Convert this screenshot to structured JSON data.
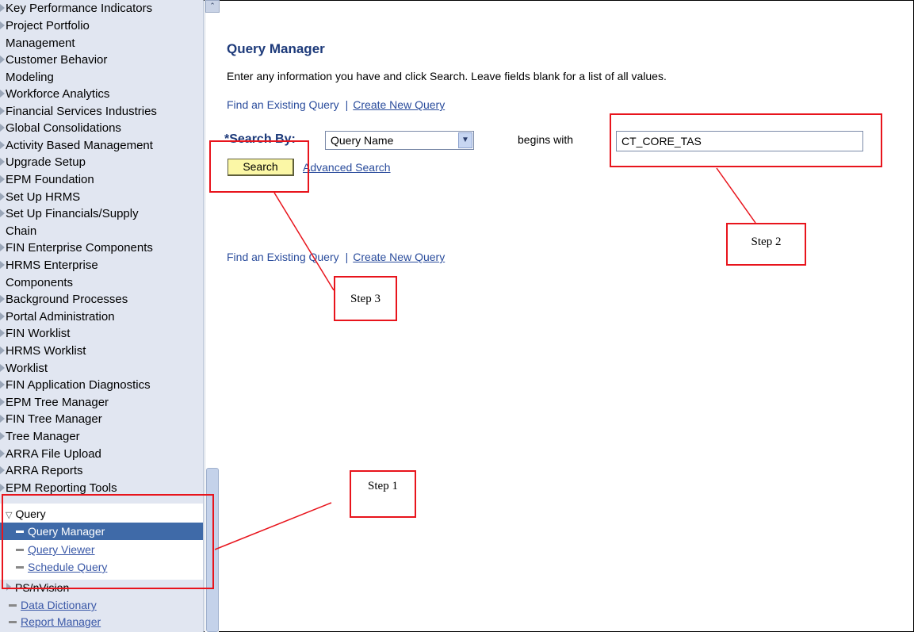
{
  "sidebar": {
    "items": [
      {
        "line1": "Key Performance Indicators",
        "line2": ""
      },
      {
        "line1": "Project Portfolio",
        "line2": "Management"
      },
      {
        "line1": "Customer Behavior",
        "line2": "Modeling"
      },
      {
        "line1": "Workforce Analytics",
        "line2": ""
      },
      {
        "line1": "Financial Services Industries",
        "line2": ""
      },
      {
        "line1": "Global Consolidations",
        "line2": ""
      },
      {
        "line1": "Activity Based Management",
        "line2": ""
      },
      {
        "line1": "Upgrade Setup",
        "line2": ""
      },
      {
        "line1": "EPM Foundation",
        "line2": ""
      },
      {
        "line1": "Set Up HRMS",
        "line2": ""
      },
      {
        "line1": "Set Up Financials/Supply",
        "line2": "Chain"
      },
      {
        "line1": "FIN Enterprise Components",
        "line2": ""
      },
      {
        "line1": "HRMS Enterprise",
        "line2": "Components"
      },
      {
        "line1": "Background Processes",
        "line2": ""
      },
      {
        "line1": "Portal Administration",
        "line2": ""
      },
      {
        "line1": "FIN Worklist",
        "line2": ""
      },
      {
        "line1": "HRMS Worklist",
        "line2": ""
      },
      {
        "line1": "Worklist",
        "line2": ""
      },
      {
        "line1": "FIN Application Diagnostics",
        "line2": ""
      },
      {
        "line1": "EPM Tree Manager",
        "line2": ""
      },
      {
        "line1": "FIN Tree Manager",
        "line2": ""
      },
      {
        "line1": "Tree Manager",
        "line2": ""
      },
      {
        "line1": "ARRA File Upload",
        "line2": ""
      },
      {
        "line1": "ARRA Reports",
        "line2": ""
      },
      {
        "line1": "EPM Reporting Tools",
        "line2": ""
      }
    ],
    "query_folder": {
      "label": "Query",
      "children": [
        "Query Manager",
        "Query Viewer",
        "Schedule Query"
      ],
      "selected": "Query Manager"
    },
    "after_items": [
      {
        "label": "PS/nVision",
        "type": "folder"
      },
      {
        "label": "Data Dictionary",
        "type": "link"
      },
      {
        "label": "Report Manager",
        "type": "link"
      }
    ]
  },
  "main": {
    "title": "Query Manager",
    "instructions": "Enter any information you have and click Search. Leave fields blank for a list of all values.",
    "find_link": "Find an Existing Query",
    "separator": "|",
    "create_link": "Create New Query",
    "search_by_label": "*Search By:",
    "search_by_value": "Query Name",
    "operator_text": "begins with",
    "search_value": "CT_CORE_TAS",
    "search_button": "Search",
    "advanced_search": "Advanced Search"
  },
  "annotations": {
    "step1": "Step 1",
    "step2": "Step 2",
    "step3": "Step 3",
    "color": "#e8141c"
  },
  "colors": {
    "sidebar_bg": "#e1e6f1",
    "selected_bg": "#3f6aa8",
    "title": "#1d3a7a",
    "link": "#2a4c9c",
    "search_button_bg": "#fbf7a6"
  }
}
